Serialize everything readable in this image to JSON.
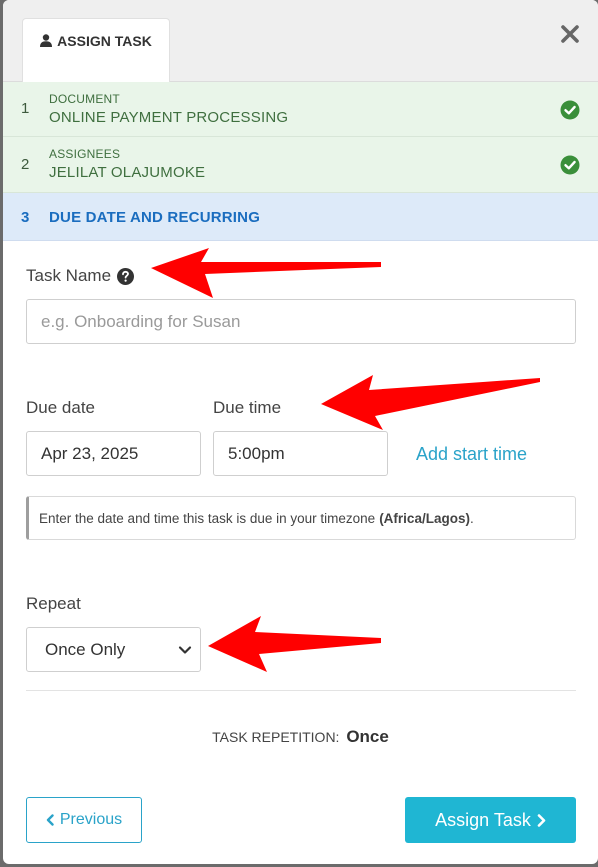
{
  "tab": {
    "label": "ASSIGN TASK",
    "icon": "user-icon"
  },
  "close": {
    "icon": "close-icon"
  },
  "steps": [
    {
      "num": "1",
      "caption": "DOCUMENT",
      "value": "ONLINE PAYMENT PROCESSING",
      "status": "done"
    },
    {
      "num": "2",
      "caption": "ASSIGNEES",
      "value": "JELILAT OLAJUMOKE",
      "status": "done"
    },
    {
      "num": "3",
      "title": "DUE DATE AND RECURRING",
      "status": "active"
    }
  ],
  "form": {
    "task_name_label": "Task Name",
    "task_name_placeholder": "e.g. Onboarding for Susan",
    "task_name_value": "",
    "due_date_label": "Due date",
    "due_date_value": "Apr 23, 2025",
    "due_time_label": "Due time",
    "due_time_value": "5:00pm",
    "add_start_time": "Add start time",
    "notice_text": "Enter the date and time this task is due in your timezone",
    "notice_timezone": "(Africa/Lagos)",
    "notice_end": ".",
    "repeat_label": "Repeat",
    "repeat_value": "Once Only",
    "repetition_label": "TASK REPETITION:",
    "repetition_value": "Once"
  },
  "buttons": {
    "previous": "Previous",
    "assign": "Assign Task"
  },
  "colors": {
    "accent": "#1fb6d3",
    "link": "#2aa3c9",
    "success": "#3a8f3a",
    "annotation_arrow": "#ff0000"
  }
}
